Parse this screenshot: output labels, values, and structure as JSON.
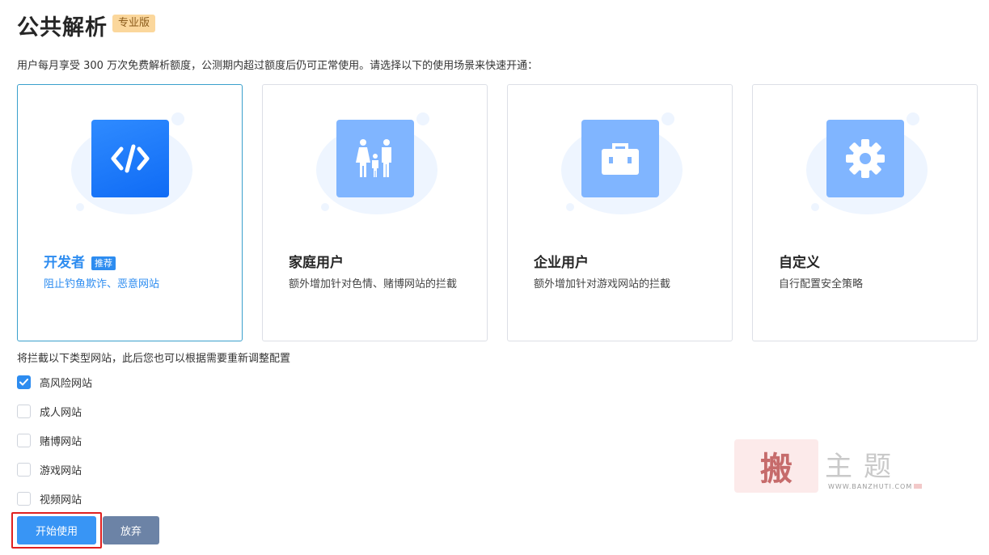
{
  "header": {
    "title": "公共解析",
    "edition_badge": "专业版"
  },
  "intro": "用户每月享受 300 万次免费解析额度，公测期内超过额度后仍可正常使用。请选择以下的使用场景来快速开通：",
  "scenarios": [
    {
      "title": "开发者",
      "badge": "推荐",
      "desc": "阻止钓鱼欺诈、恶意网站",
      "icon": "code-icon",
      "selected": true
    },
    {
      "title": "家庭用户",
      "desc": "额外增加针对色情、赌博网站的拦截",
      "icon": "family-icon",
      "selected": false
    },
    {
      "title": "企业用户",
      "desc": "额外增加针对游戏网站的拦截",
      "icon": "briefcase-icon",
      "selected": false
    },
    {
      "title": "自定义",
      "desc": "自行配置安全策略",
      "icon": "gear-icon",
      "selected": false
    }
  ],
  "block_section": {
    "label": "将拦截以下类型网站，此后您也可以根据需要重新调整配置",
    "options": [
      {
        "label": "高风险网站",
        "checked": true
      },
      {
        "label": "成人网站",
        "checked": false
      },
      {
        "label": "赌博网站",
        "checked": false
      },
      {
        "label": "游戏网站",
        "checked": false
      },
      {
        "label": "视频网站",
        "checked": false
      }
    ]
  },
  "actions": {
    "start_label": "开始使用",
    "abandon_label": "放弃"
  },
  "watermark": {
    "stamp": "搬",
    "text": "主题",
    "url": "WWW.BANZHUTI.COM"
  },
  "colors": {
    "accent": "#2d8cf0",
    "primary_button": "#3895f5",
    "secondary_button": "#6c83a6",
    "selected_border": "#3aa0cc",
    "badge_bg": "#fbd79c",
    "focus_outline": "#e02020"
  }
}
